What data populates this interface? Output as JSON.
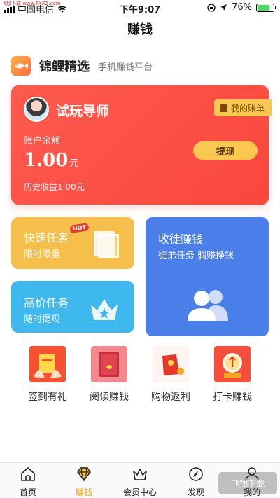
{
  "status_bar": {
    "carrier": "中国电信",
    "time": "下午9:07",
    "battery": "76%",
    "battery_level": 0.76,
    "watermark": "飞翔下载 www.FXXZ.com"
  },
  "header": {
    "title": "赚钱"
  },
  "brand": {
    "name": "锦鲤精选",
    "slogan": "手机赚钱平台"
  },
  "account": {
    "role": "试玩导师",
    "my_bill": "我的账单",
    "balance_label": "账户余额",
    "balance": "1.00",
    "unit": "元",
    "history": "历史收益1.00元",
    "withdraw": "提现"
  },
  "tasks": {
    "fast": {
      "title": "快速任务",
      "subtitle": "限时限量",
      "badge": "HOT"
    },
    "high": {
      "title": "高价任务",
      "subtitle": "随时提现"
    },
    "disciple": {
      "title": "收徒赚钱",
      "subtitle": "徒弟任务 躺赚挣钱"
    }
  },
  "quick_items": [
    {
      "label": "签到有礼",
      "icon": "gift-envelope-icon"
    },
    {
      "label": "阅读赚钱",
      "icon": "book-read-icon"
    },
    {
      "label": "购物返利",
      "icon": "shopping-rebate-icon"
    },
    {
      "label": "打卡赚钱",
      "icon": "checkin-icon"
    }
  ],
  "tabbar": [
    {
      "label": "首页",
      "icon": "home-icon"
    },
    {
      "label": "赚钱",
      "icon": "diamond-icon",
      "active": true
    },
    {
      "label": "会员中心",
      "icon": "crown-icon"
    },
    {
      "label": "发现",
      "icon": "compass-icon"
    },
    {
      "label": "我的",
      "icon": "profile-icon"
    }
  ],
  "watermark_br": "飞翔下载",
  "colors": {
    "accent": "#f0a21a",
    "card_red": "#f9473d",
    "gold": "#f8c850",
    "blue": "#4a7ee8",
    "sky": "#3fb8ef"
  }
}
